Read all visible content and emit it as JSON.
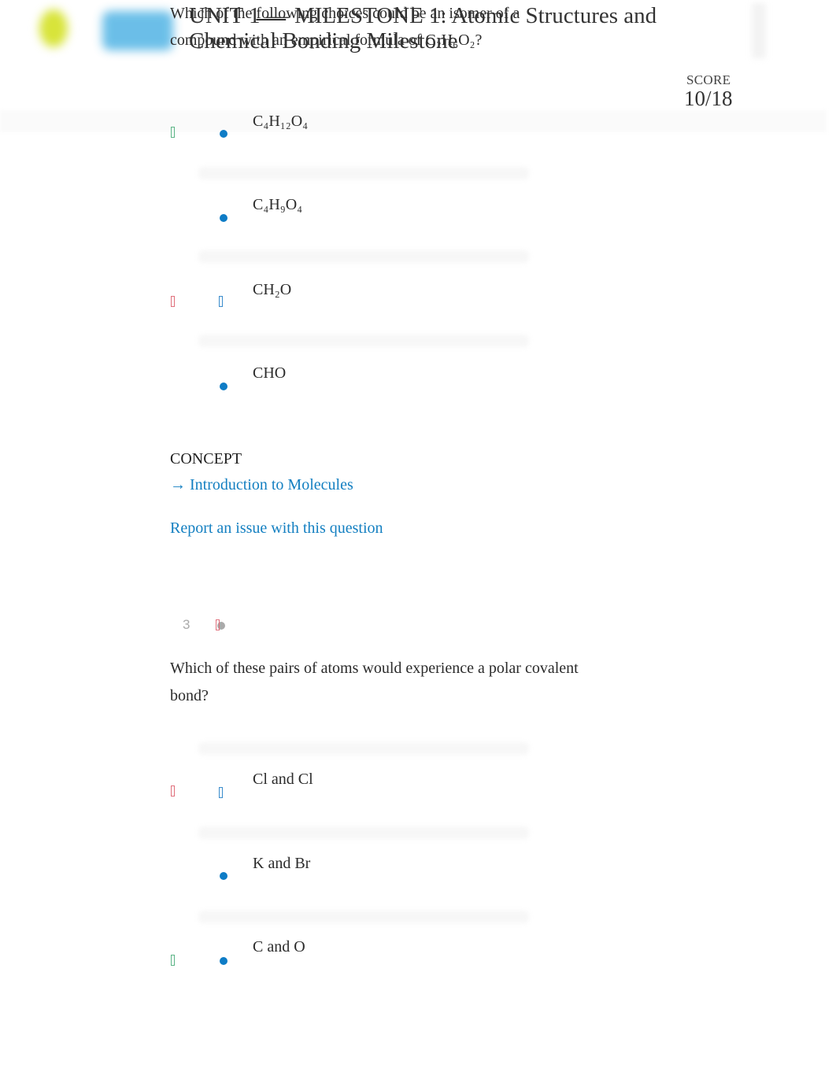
{
  "header": {
    "title": "UNIT 1 — MILESTONE 1: Atomic Structures and Chemical Bonding Milestone",
    "score_label": "SCORE",
    "score_value": "10/18"
  },
  "question1": {
    "text_pre": "Which of the ",
    "text_underlined": "follo",
    "text_post": "wing choices could be an isomer of a compound with an empirical formula of C₂H₆O₂?",
    "options": [
      {
        "label": "C₄H₁₂O₄",
        "marker": "radio",
        "status_icon": "correct-icon"
      },
      {
        "label": "C₄H₉O₄",
        "marker": "radio",
        "status_icon": ""
      },
      {
        "label": "CH₂O",
        "marker": "selected-icon",
        "status_icon": "incorrect-icon"
      },
      {
        "label": "CHO",
        "marker": "radio",
        "status_icon": ""
      }
    ],
    "concept_label": "CONCEPT",
    "concept_link": "→ Introduction to Molecules",
    "report_link": "Report an issue with this question"
  },
  "question2": {
    "number": "3",
    "status_icon": "incorrect-icon",
    "text": "Which of these pairs of atoms would experience a polar covalent bond?",
    "options": [
      {
        "label": "Cl and Cl",
        "marker": "selected-icon",
        "status_icon": "incorrect-icon"
      },
      {
        "label": "K and Br",
        "marker": "radio",
        "status_icon": ""
      },
      {
        "label": "C and O",
        "marker": "radio",
        "status_icon": "correct-icon"
      }
    ]
  },
  "colors": {
    "accent": "#137fc1",
    "radio": "#0e7cc6",
    "correct": "#5bb486",
    "incorrect": "#e0707c"
  }
}
